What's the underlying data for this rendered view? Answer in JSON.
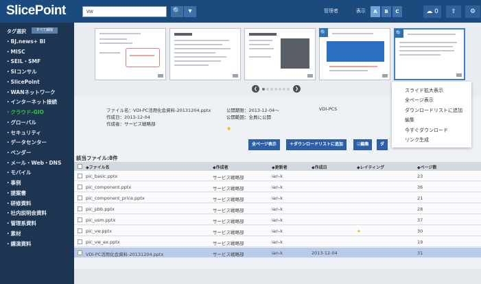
{
  "app": {
    "logo": "SlicePoint",
    "search_value": "vw",
    "search_button": "🔍",
    "dropdown_button": "▾",
    "admin_label": "管理者",
    "display_size_label": "表示",
    "size_buttons": [
      {
        "label": "A",
        "active": true
      },
      {
        "label": "B",
        "active": false
      },
      {
        "label": "C",
        "active": false
      }
    ],
    "cloud_count": "0",
    "icons": [
      "cloud-icon",
      "upload-icon",
      "gear-icon"
    ]
  },
  "sidebar": {
    "tag_select_label": "タグ選択",
    "tag_button": "すべて解除",
    "items": [
      {
        "label": "・BJ.news+ BI"
      },
      {
        "label": "・MISC"
      },
      {
        "label": "・SEIL・SMF"
      },
      {
        "label": "・SIコンサル"
      },
      {
        "label": "・SlicePoint"
      },
      {
        "label": "・WANネットワーク"
      },
      {
        "label": "・インターネット接続"
      },
      {
        "label": "・クラウド-GIO",
        "current": true
      },
      {
        "label": "・グローバル"
      },
      {
        "label": "・セキュリティ"
      },
      {
        "label": "・データセンター"
      },
      {
        "label": "・ベンダー"
      },
      {
        "label": "・メール・Web・DNS"
      },
      {
        "label": "・モバイル"
      },
      {
        "label": "・事例"
      },
      {
        "label": "・提案書"
      },
      {
        "label": "・研修資料"
      },
      {
        "label": "・社内説明会資料"
      },
      {
        "label": "・管理系資料"
      },
      {
        "label": "・素材"
      },
      {
        "label": "・講演資料"
      }
    ]
  },
  "preview": {
    "dots_count": 7,
    "active_dot": 0,
    "prev_icon": "❮",
    "next_icon": "❯"
  },
  "info": {
    "file_name": "ファイル名：VDI-PC活用化会資料-20131204.pptx",
    "created_date": "作成日：2013-12-04",
    "author": "作成者：サービス戦略部",
    "published_date": "公開期限：2013-12-04～",
    "published_scope": "公開範囲：全員に公開",
    "tag": "VDI-PCS"
  },
  "actions": {
    "all_pages": "全ページ表示",
    "add_download": "＋ダウンロードリストに追加",
    "edit": "☑編集",
    "more": "ダ"
  },
  "context_menu": [
    "スライド拡大表示",
    "全ページ表示",
    "ダウンロードリストに追加",
    "編集",
    "今すぐダウンロード",
    "リンク生成"
  ],
  "table": {
    "count_label": "該当ファイル:8件",
    "headers": [
      "◆ファイル名",
      "◆作成者",
      "◆更新者",
      "◆作成日",
      "◆レイティング",
      "◆ページ数"
    ],
    "rows": [
      {
        "name": "pic_basic.pptx",
        "author": "サービス戦略部",
        "updater": "ian-k",
        "date": "",
        "rating": "",
        "pages": "23",
        "selected": false
      },
      {
        "name": "pic_component.pptx",
        "author": "サービス戦略部",
        "updater": "ian-k",
        "date": "",
        "rating": "",
        "pages": "36",
        "selected": false
      },
      {
        "name": "pic_component_price.pptx",
        "author": "サービス戦略部",
        "updater": "ian-k",
        "date": "",
        "rating": "",
        "pages": "21",
        "selected": false
      },
      {
        "name": "pic_pbb.pptx",
        "author": "サービス戦略部",
        "updater": "ian-k",
        "date": "",
        "rating": "",
        "pages": "28",
        "selected": false
      },
      {
        "name": "pic_usm.pptx",
        "author": "サービス戦略部",
        "updater": "ian-k",
        "date": "",
        "rating": "",
        "pages": "37",
        "selected": false
      },
      {
        "name": "pic_vw.pptx",
        "author": "サービス戦略部",
        "updater": "ian-k",
        "date": "",
        "rating": "★",
        "pages": "30",
        "selected": false
      },
      {
        "name": "pic_vw_ex.pptx",
        "author": "サービス戦略部",
        "updater": "ian-k",
        "date": "",
        "rating": "",
        "pages": "19",
        "selected": false
      },
      {
        "name": "VDI-PC活用化会資料-20131204.pptx",
        "author": "サービス戦略部",
        "updater": "ian-k",
        "date": "2013-12-04",
        "rating": "",
        "pages": "31",
        "selected": true
      }
    ]
  },
  "colors": {
    "topbar": "#1b4a7e",
    "sidebar": "#1e3552",
    "current_tag": "#32c63a",
    "accent": "#2d5fa6",
    "selected_row": "#b8cbe8"
  }
}
